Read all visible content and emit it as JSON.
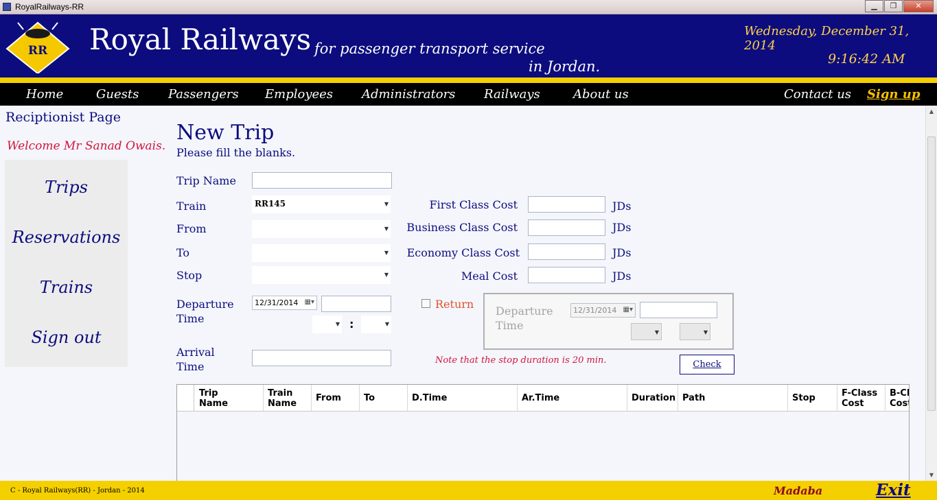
{
  "window": {
    "title": "RoyalRailways-RR",
    "min": "▁",
    "max": "❐",
    "close": "✕"
  },
  "header": {
    "brand": "Royal Railways",
    "tagline_line1": "for passenger transport service",
    "tagline_line2": "in Jordan.",
    "date": "Wednesday, December 31, 2014",
    "time": "9:16:42 AM",
    "logo_text": "RR",
    "colors": {
      "banner": "#0c0c7e",
      "gold": "#f5d000",
      "accent": "#ffd24a"
    }
  },
  "menu": {
    "home": "Home",
    "guests": "Guests",
    "passengers": "Passengers",
    "employees": "Employees",
    "administrators": "Administrators",
    "railways": "Railways",
    "about": "About us",
    "contact": "Contact us",
    "signup": "Sign up"
  },
  "sidebar": {
    "page_title": "Reciptionist Page",
    "welcome": "Welcome Mr Sanad Owais.",
    "items": [
      "Trips",
      "Reservations",
      "Trains",
      "Sign out"
    ]
  },
  "form": {
    "title": "New Trip",
    "subtitle": "Please fill the blanks.",
    "trip_name_label": "Trip Name",
    "trip_name_value": "",
    "train_label": "Train",
    "train_value": "RR145",
    "from_label": "From",
    "to_label": "To",
    "stop_label": "Stop",
    "departure_label_1": "Departure",
    "departure_label_2": "Time",
    "departure_date": "12/31/2014",
    "arrival_label_1": "Arrival",
    "arrival_label_2": "Time",
    "colon": ":",
    "first_class_label": "First Class Cost",
    "business_class_label": "Business Class Cost",
    "economy_class_label": "Economy Class Cost",
    "meal_cost_label": "Meal Cost",
    "currency": "JDs",
    "return_label": "Return",
    "return_departure_1": "Departure",
    "return_departure_2": "Time",
    "return_date": "12/31/2014",
    "note": "Note that the stop duration is 20 min.",
    "check_button": "Check"
  },
  "grid": {
    "columns": [
      {
        "l1": "Trip",
        "l2": "Name"
      },
      {
        "l1": "Train",
        "l2": "Name"
      },
      {
        "l1": "From",
        "l2": ""
      },
      {
        "l1": "To",
        "l2": ""
      },
      {
        "l1": "D.Time",
        "l2": ""
      },
      {
        "l1": "Ar.Time",
        "l2": ""
      },
      {
        "l1": "Duration",
        "l2": ""
      },
      {
        "l1": "Path",
        "l2": ""
      },
      {
        "l1": "Stop",
        "l2": ""
      },
      {
        "l1": "F-Class",
        "l2": "Cost"
      },
      {
        "l1": "B-Cl",
        "l2": "Cost"
      }
    ]
  },
  "footer": {
    "copyright": "C - Royal Railways(RR) - Jordan - 2014",
    "city": "Madaba",
    "exit": "Exit"
  }
}
